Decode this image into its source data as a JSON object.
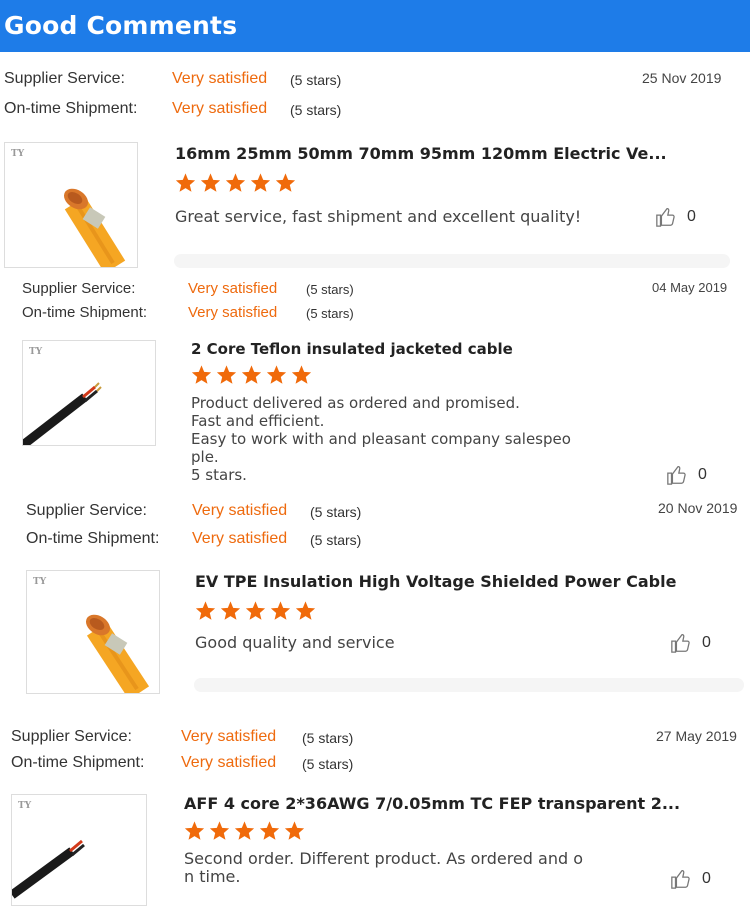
{
  "header": {
    "title": "Good Comments"
  },
  "colors": {
    "header_bg": "#1e7ce8",
    "accent": "#ee6a0e",
    "star": "#f06a0a"
  },
  "labels": {
    "supplier_service": "Supplier Service:",
    "ontime_shipment": "On-time Shipment:",
    "rating_value": "Very satisfied",
    "rating_stars": "(5 stars)"
  },
  "reviews": [
    {
      "date": "25 Nov 2019",
      "product_title": "16mm 25mm 50mm 70mm 95mm 120mm Electric Ve...",
      "rating": 5,
      "comment": "Great service, fast shipment and excellent quality!",
      "likes": "0",
      "thumb_icon": "orange-cable-image"
    },
    {
      "date": "04 May 2019",
      "product_title": "2 Core Teflon insulated jacketed cable",
      "rating": 5,
      "comment": "Product delivered as ordered and promised.\nFast and efficient.\nEasy to work with and pleasant company salespeo\nple.\n5 stars.",
      "likes": "0",
      "thumb_icon": "black-cable-image"
    },
    {
      "date": "20 Nov 2019",
      "product_title": "EV TPE Insulation High Voltage Shielded Power Cable",
      "rating": 5,
      "comment": "Good quality and service",
      "likes": "0",
      "thumb_icon": "orange-cable-image"
    },
    {
      "date": "27 May 2019",
      "product_title": "AFF 4 core 2*36AWG 7/0.05mm TC FEP transparent 2...",
      "rating": 5,
      "comment": "Second order. Different product. As ordered and o\nn time.",
      "likes": "0",
      "thumb_icon": "black-cable-image"
    }
  ]
}
